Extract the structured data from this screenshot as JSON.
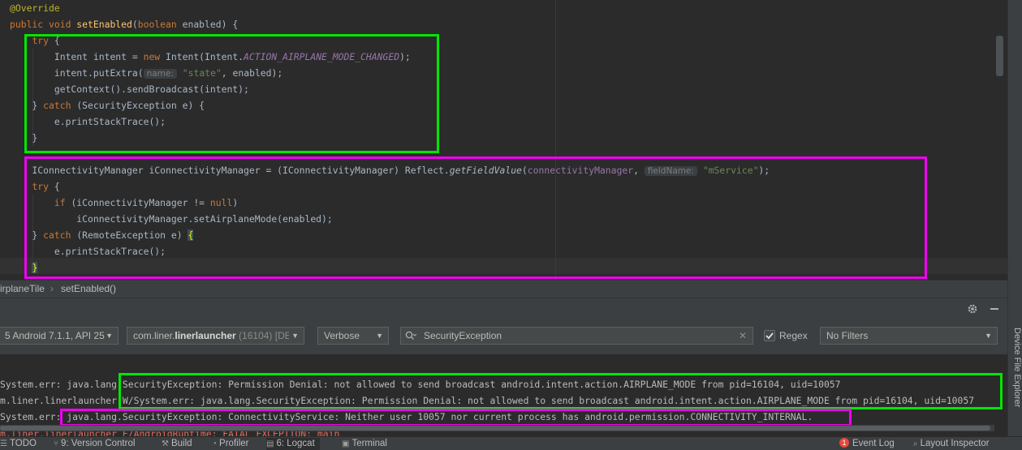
{
  "editor": {
    "lines": [
      {
        "segments": [
          {
            "t": "@Override",
            "c": "ann"
          }
        ]
      },
      {
        "segments": [
          {
            "t": "public void ",
            "c": "kw"
          },
          {
            "t": "setEnabled",
            "c": "fn"
          },
          {
            "t": "(",
            "c": ""
          },
          {
            "t": "boolean ",
            "c": "kw"
          },
          {
            "t": "enabled) {",
            "c": ""
          }
        ]
      },
      {
        "segments": [
          {
            "t": "    "
          },
          {
            "t": "try ",
            "c": "kw"
          },
          {
            "t": "{",
            "c": ""
          }
        ]
      },
      {
        "segments": [
          {
            "t": "        Intent intent = "
          },
          {
            "t": "new ",
            "c": "kw"
          },
          {
            "t": "Intent(Intent."
          },
          {
            "t": "ACTION_AIRPLANE_MODE_CHANGED",
            "c": "cst"
          },
          {
            "t": ");"
          }
        ]
      },
      {
        "segments": [
          {
            "t": "        intent.putExtra("
          },
          {
            "t": "name:",
            "c": "hint"
          },
          {
            "t": " "
          },
          {
            "t": "\"state\"",
            "c": "str"
          },
          {
            "t": ", enabled);"
          }
        ]
      },
      {
        "segments": [
          {
            "t": "        getContext().sendBroadcast(intent);"
          }
        ]
      },
      {
        "segments": [
          {
            "t": "    } "
          },
          {
            "t": "catch ",
            "c": "kw"
          },
          {
            "t": "(SecurityException e) {"
          }
        ]
      },
      {
        "segments": [
          {
            "t": "        e.printStackTrace();"
          }
        ]
      },
      {
        "segments": [
          {
            "t": "    }"
          }
        ]
      },
      {
        "segments": []
      },
      {
        "segments": [
          {
            "t": "    IConnectivityManager iConnectivityManager = (IConnectivityManager) Reflect."
          },
          {
            "t": "getFieldValue",
            "c": "it"
          },
          {
            "t": "("
          },
          {
            "t": "connectivityManager",
            "c": "fld"
          },
          {
            "t": ", "
          },
          {
            "t": "fieldName:",
            "c": "hint"
          },
          {
            "t": " "
          },
          {
            "t": "\"mService\"",
            "c": "str"
          },
          {
            "t": ");"
          }
        ]
      },
      {
        "segments": [
          {
            "t": "    "
          },
          {
            "t": "try ",
            "c": "kw"
          },
          {
            "t": "{"
          }
        ]
      },
      {
        "segments": [
          {
            "t": "        "
          },
          {
            "t": "if ",
            "c": "kw"
          },
          {
            "t": "(iConnectivityManager != "
          },
          {
            "t": "null",
            "c": "kw"
          },
          {
            "t": ")"
          }
        ]
      },
      {
        "segments": [
          {
            "t": "            iConnectivityManager.setAirplaneMode(enabled);"
          }
        ]
      },
      {
        "segments": [
          {
            "t": "    } "
          },
          {
            "t": "catch ",
            "c": "kw"
          },
          {
            "t": "(RemoteException e) "
          },
          {
            "t": "{",
            "c": "brace-hl"
          }
        ]
      },
      {
        "segments": [
          {
            "t": "        e.printStackTrace();"
          }
        ]
      },
      {
        "segments": [
          {
            "t": "    "
          },
          {
            "t": "}",
            "c": "brace-hl"
          }
        ]
      }
    ]
  },
  "breadcrumb": {
    "items": [
      "irplaneTile",
      "setEnabled()"
    ],
    "separator": "›"
  },
  "panel": {
    "settings_icon": "gear-icon",
    "hide_icon": "minimize-icon"
  },
  "logcat": {
    "device": "5 Android 7.1.1, API 25",
    "process_name": "com.liner.",
    "process_bold": "linerlauncher",
    "process_pid": " (16104) [DE",
    "level": "Verbose",
    "search_value": "SecurityException",
    "regex_label": "Regex",
    "regex_checked": true,
    "filter": "No Filters",
    "lines": [
      "System.err: java.lang.SecurityException: Permission Denial: not allowed to send broadcast android.intent.action.AIRPLANE_MODE from pid=16104, uid=10057",
      "m.liner.linerlauncher W/System.err: java.lang.SecurityException: Permission Denial: not allowed to send broadcast android.intent.action.AIRPLANE_MODE from pid=16104, uid=10057",
      "System.err: java.lang.SecurityException: ConnectivityService: Neither user 10057 nor current process has android.permission.CONNECTIVITY_INTERNAL.",
      "m.liner.linerlauncher E/AndroidRuntime: FATAL EXCEPTION: main"
    ]
  },
  "side_tool": {
    "device_file_explorer": "Device File Explorer"
  },
  "statusbar": {
    "left": [
      {
        "icon": "todo-icon",
        "label": "TODO"
      },
      {
        "icon": "version-control-icon",
        "label": "9: Version Control"
      },
      {
        "icon": "hammer-icon",
        "label": "Build"
      },
      {
        "icon": "profiler-icon",
        "label": "Profiler"
      },
      {
        "icon": "logcat-icon",
        "label": "6: Logcat"
      },
      {
        "icon": "terminal-icon",
        "label": "Terminal"
      }
    ],
    "event_log_count": "1",
    "event_log": "Event Log",
    "layout_inspector": "Layout Inspector"
  },
  "colors": {
    "green_box": "#00e600",
    "pink_box": "#f000f0",
    "error_badge": "#e5493a"
  }
}
